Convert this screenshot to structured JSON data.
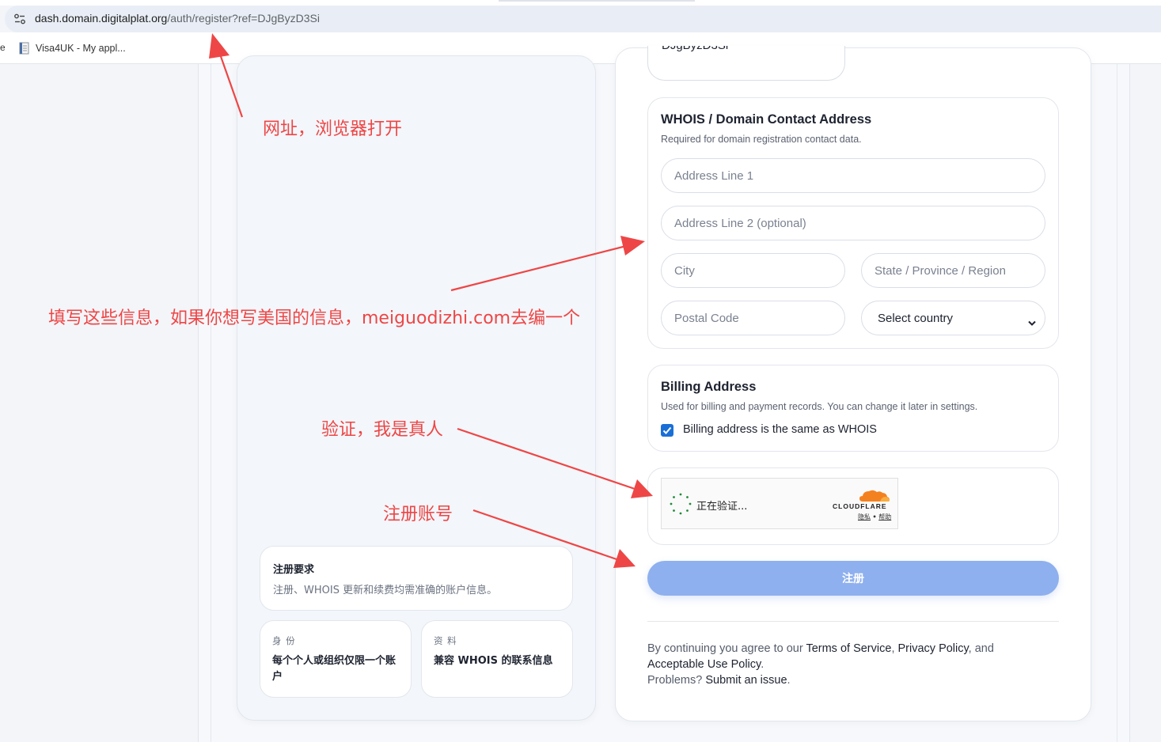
{
  "browser": {
    "url_domain": "dash.domain.digitalplat.org",
    "url_path": "/auth/register?ref=DJgByzD3Si",
    "bookmark_truncated": "e",
    "bookmark_label": "Visa4UK - My appl..."
  },
  "form": {
    "ref_value": "DJgByzD3Si",
    "whois": {
      "title": "WHOIS / Domain Contact Address",
      "subtitle": "Required for domain registration contact data.",
      "address1_placeholder": "Address Line 1",
      "address2_placeholder": "Address Line 2 (optional)",
      "city_placeholder": "City",
      "state_placeholder": "State / Province / Region",
      "postal_placeholder": "Postal Code",
      "country_selected": "Select country"
    },
    "billing": {
      "title": "Billing Address",
      "subtitle": "Used for billing and payment records. You can change it later in settings.",
      "same_label": "Billing address is the same as WHOIS",
      "same_checked": true
    },
    "turnstile": {
      "status": "正在验证...",
      "brand": "CLOUDFLARE",
      "privacy": "隐私",
      "separator": "•",
      "help": "帮助"
    },
    "submit_label": "注册",
    "legal": {
      "prefix": "By continuing you agree to our ",
      "terms": "Terms of Service",
      "comma": ", ",
      "privacy": "Privacy Policy",
      "and": ", and",
      "aup": "Acceptable Use Policy",
      "period": ".",
      "problems": "Problems? ",
      "submit_issue": "Submit an issue",
      "period2": "."
    }
  },
  "left": {
    "requirements_title": "注册要求",
    "requirements_body": "注册、WHOIS 更新和续费均需准确的账户信息。",
    "identity_label": "身 份",
    "identity_value": "每个个人或组织仅限一个账户",
    "profile_label": "资 料",
    "profile_value": "兼容 WHOIS 的联系信息"
  },
  "annotations": {
    "url_note": "网址，浏览器打开",
    "fill_note": "填写这些信息，如果你想写美国的信息，meiguodizhi.com去编一个",
    "verify_note": "验证，我是真人",
    "register_note": "注册账号",
    "color": "#ee4646"
  }
}
